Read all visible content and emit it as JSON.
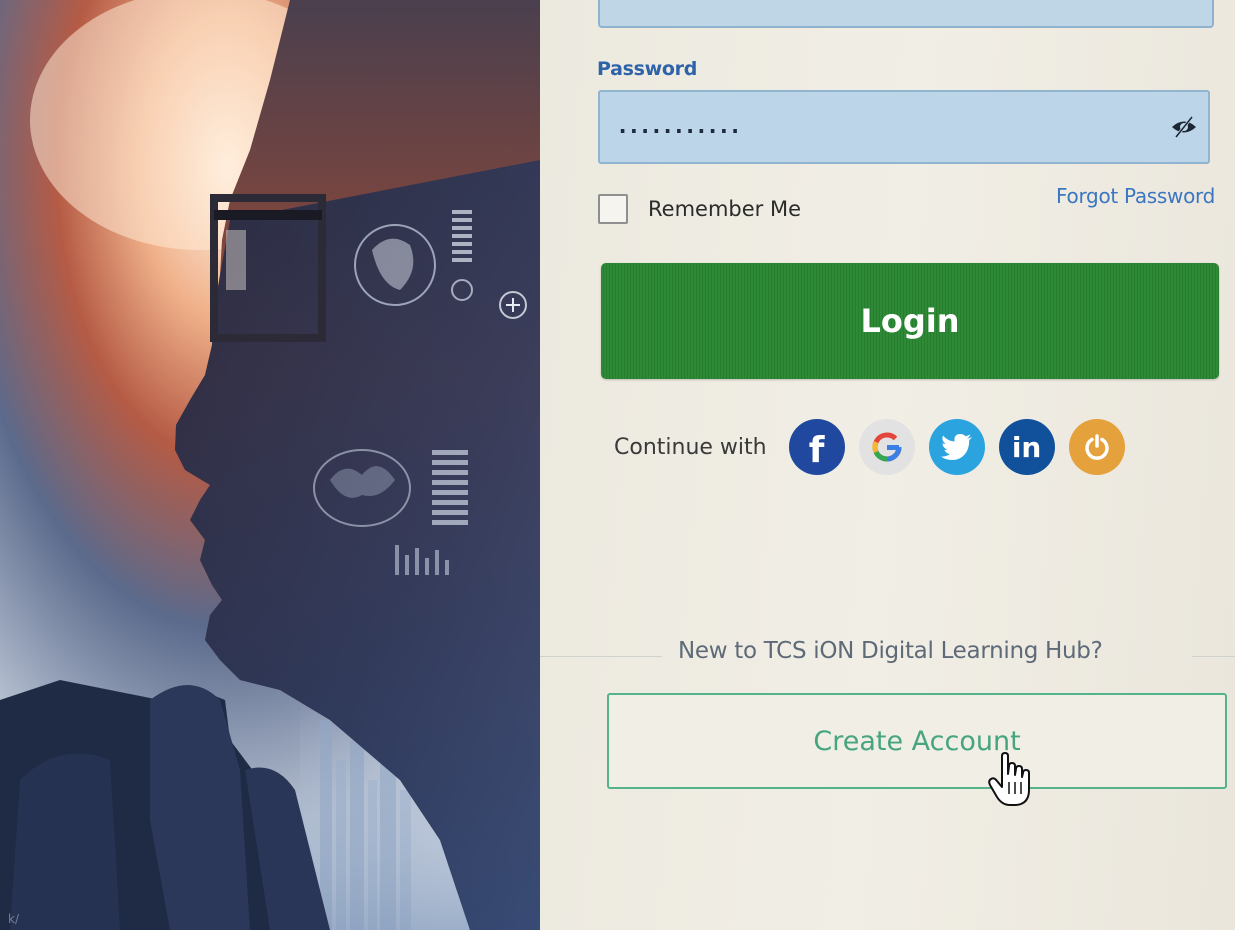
{
  "login": {
    "password_label": "Password",
    "password_value": "...........",
    "remember_label": "Remember Me",
    "forgot_label": "Forgot Password",
    "login_label": "Login"
  },
  "social": {
    "continue_label": "Continue with",
    "providers": [
      {
        "name": "facebook",
        "glyph": "f",
        "color": "#20489f"
      },
      {
        "name": "google",
        "glyph": "G",
        "color": "#e2e2e2"
      },
      {
        "name": "twitter",
        "glyph": "bird",
        "color": "#2aa3df"
      },
      {
        "name": "linkedin",
        "glyph": "in",
        "color": "#11519b"
      },
      {
        "name": "power",
        "glyph": "power",
        "color": "#e5a13b"
      }
    ]
  },
  "signup": {
    "prompt": "New to TCS iON Digital Learning Hub?",
    "create_label": "Create Account"
  },
  "hero": {
    "url_fragment": "k/"
  },
  "colors": {
    "accent_blue": "#2f63a9",
    "login_green": "#2e8a36",
    "create_green": "#46a57f",
    "field_blue": "#bdd5e8"
  }
}
